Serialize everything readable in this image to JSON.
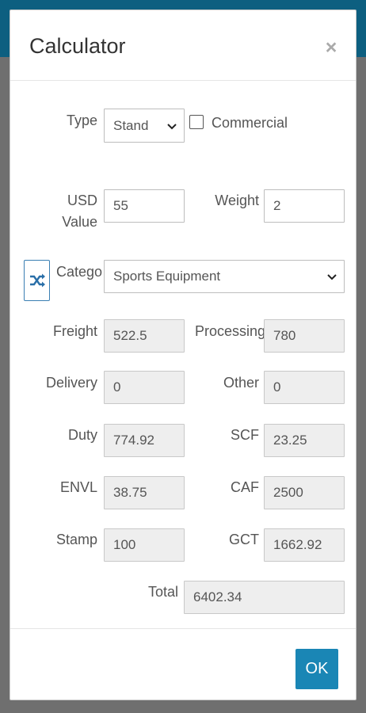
{
  "modal": {
    "title": "Calculator",
    "close_symbol": "×"
  },
  "type": {
    "label": "Type",
    "selected": "Stand",
    "commercial_label": "Commercial",
    "commercial_checked": false
  },
  "usd": {
    "label_line1": "USD",
    "label_line2": "Value",
    "value": "55"
  },
  "weight": {
    "label": "Weight",
    "value": "2"
  },
  "category": {
    "label": "Catego",
    "selected": "Sports Equipment",
    "shuffle_icon": "shuffle-icon"
  },
  "results": {
    "freight": {
      "label": "Freight",
      "value": "522.5"
    },
    "processing": {
      "label": "Processing",
      "value": "780"
    },
    "delivery": {
      "label": "Delivery",
      "value": "0"
    },
    "other": {
      "label": "Other",
      "value": "0"
    },
    "duty": {
      "label": "Duty",
      "value": "774.92"
    },
    "scf": {
      "label": "SCF",
      "value": "23.25"
    },
    "envl": {
      "label": "ENVL",
      "value": "38.75"
    },
    "caf": {
      "label": "CAF",
      "value": "2500"
    },
    "stamp": {
      "label": "Stamp",
      "value": "100"
    },
    "gct": {
      "label": "GCT",
      "value": "1662.92"
    },
    "total": {
      "label": "Total",
      "value": "6402.34"
    }
  },
  "footer": {
    "ok_label": "OK"
  },
  "colors": {
    "topbar": "#0d5f80",
    "overlay": "#6f6f6f",
    "primary": "#1a86b5",
    "shuffle_icon": "#2a6fa8"
  }
}
